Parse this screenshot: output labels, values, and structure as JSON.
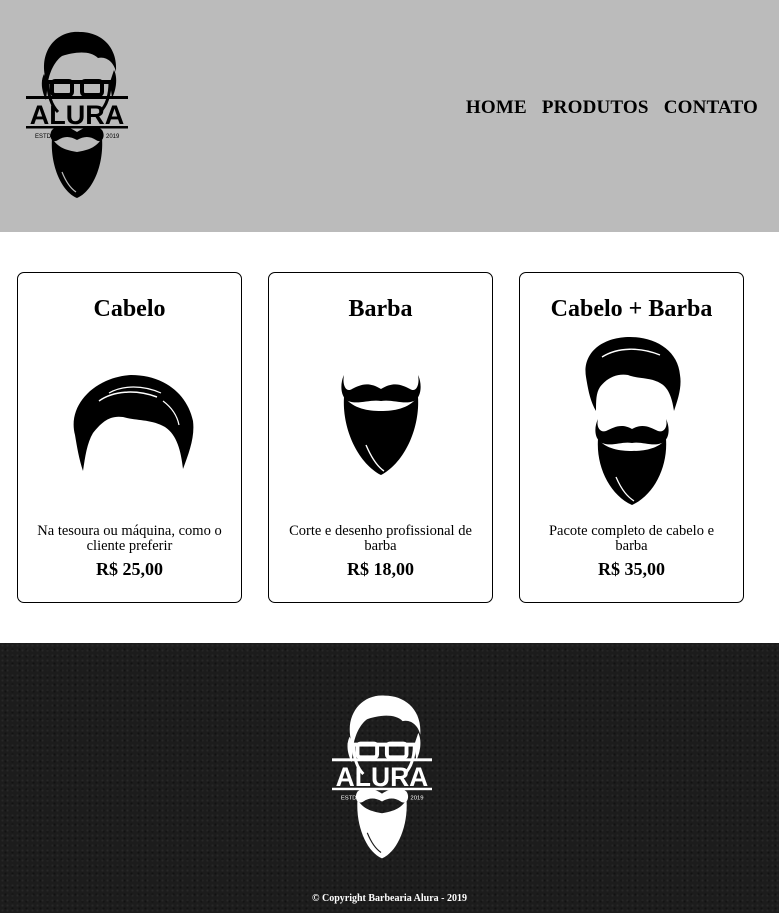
{
  "header": {
    "logo": {
      "text": "ALURA",
      "left_text": "ESTD",
      "right_text": "2019"
    },
    "nav": [
      "HOME",
      "PRODUTOS",
      "CONTATO"
    ]
  },
  "products": [
    {
      "title": "Cabelo",
      "description": "Na tesoura ou máquina, como o cliente preferir",
      "price": "R$ 25,00",
      "icon": "hair-icon"
    },
    {
      "title": "Barba",
      "description": "Corte e desenho profissional de barba",
      "price": "R$ 18,00",
      "icon": "beard-icon"
    },
    {
      "title": "Cabelo + Barba",
      "description": "Pacote completo de cabelo e barba",
      "price": "R$ 35,00",
      "icon": "hair-and-beard-icon"
    }
  ],
  "footer": {
    "logo": {
      "text": "ALURA",
      "left_text": "ESTD",
      "right_text": "2019"
    },
    "copyright": "© Copyright Barbearia Alura - 2019"
  },
  "colors": {
    "header_bg": "#bbbbbb",
    "footer_bg": "#1c1c1c"
  }
}
